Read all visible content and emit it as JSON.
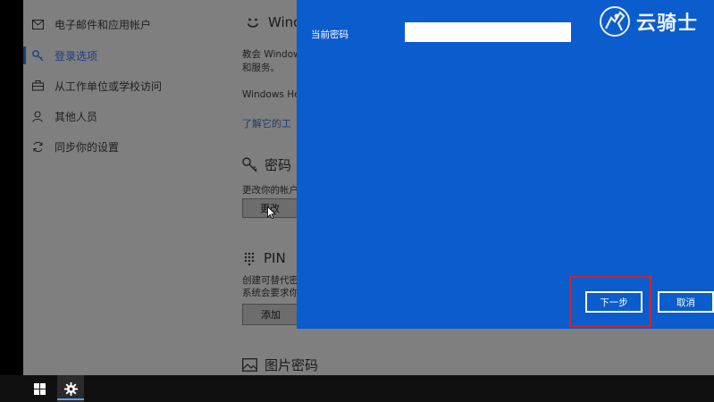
{
  "sidebar": {
    "items": [
      {
        "label": "电子邮件和应用帐户",
        "icon": "mail-icon"
      },
      {
        "label": "登录选项",
        "icon": "key-icon"
      },
      {
        "label": "从工作单位或学校访问",
        "icon": "briefcase-icon"
      },
      {
        "label": "其他人员",
        "icon": "person-icon"
      },
      {
        "label": "同步你的设置",
        "icon": "sync-icon"
      }
    ]
  },
  "main": {
    "hello": {
      "title": "Wind",
      "desc1": "教会 Window",
      "desc2": "和服务。",
      "desc3": "Windows He",
      "link": "了解它的工"
    },
    "password": {
      "title": "密码",
      "desc": "更改你的帐户",
      "button": "更改"
    },
    "pin": {
      "title": "PIN",
      "desc1": "创建可替代密",
      "desc2": "系统会要求你",
      "button": "添加"
    },
    "picture": {
      "title": "图片密码"
    }
  },
  "dialog": {
    "current_password_label": "当前密码",
    "current_password_value": "",
    "next_button": "下一步",
    "cancel_button": "取消"
  },
  "watermark": {
    "text": "云骑士"
  },
  "colors": {
    "dialog_bg": "#0b5ccc",
    "highlight": "#d32424",
    "settings_bg": "#7f7f7f",
    "taskbar": "#101010"
  }
}
